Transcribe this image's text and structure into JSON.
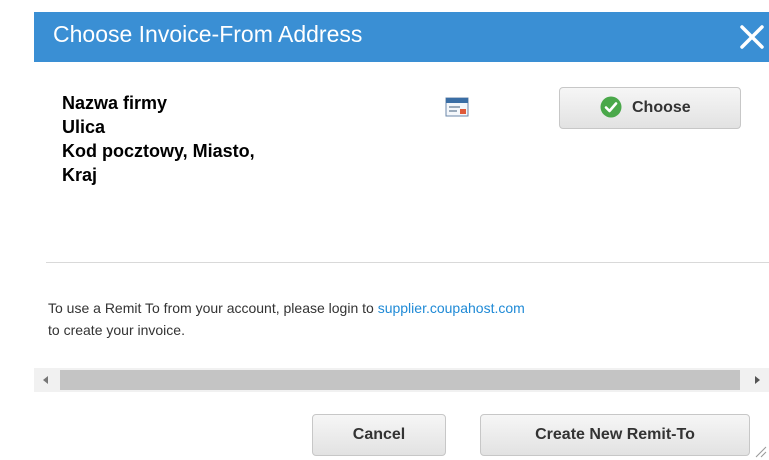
{
  "dialog": {
    "title": "Choose Invoice-From Address",
    "close_label": "✕"
  },
  "address": {
    "lines": [
      "Nazwa firmy",
      "Ulica",
      "Kod pocztowy, Miasto,",
      "Kraj"
    ],
    "choose_label": "Choose"
  },
  "info": {
    "text_before": "To use a Remit To from your account, please login to ",
    "link_text": "supplier.coupahost.com",
    "text_after": " to create your invoice."
  },
  "footer": {
    "cancel_label": "Cancel",
    "create_label": "Create New Remit-To"
  },
  "colors": {
    "title_bar": "#3a8fd4",
    "link": "#1f8ad6",
    "check": "#4aa84a"
  },
  "icons": {
    "close": "close-icon",
    "address_card": "address-card-icon",
    "choose": "check-circle-icon",
    "scroll_left": "chevron-left-icon",
    "scroll_right": "chevron-right-icon",
    "resize": "resize-grip-icon"
  }
}
